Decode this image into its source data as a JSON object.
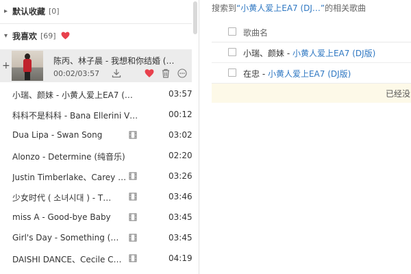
{
  "sidebar": {
    "default_fav": {
      "title": "默认收藏",
      "count": "[0]"
    },
    "liked": {
      "title": "我喜欢",
      "count": "[69]"
    }
  },
  "now_playing": {
    "title": "陈丙、林子晨 - 我想和你结婚 (…",
    "time": "00:02/03:57"
  },
  "songs": [
    {
      "name": "小瑞、颜妹 - 小黄人爱上EA7 (…",
      "duration": "03:57",
      "mv": false
    },
    {
      "name": "科科不是科科 - Bana Ellerini V…",
      "duration": "00:12",
      "mv": false
    },
    {
      "name": "Dua Lipa - Swan Song",
      "duration": "03:02",
      "mv": true
    },
    {
      "name": "Alonzo - Determine (纯音乐)",
      "duration": "02:20",
      "mv": false
    },
    {
      "name": "Justin Timberlake、Carey …",
      "duration": "03:26",
      "mv": true
    },
    {
      "name": "少女时代 ( 소녀시대 ) - T…",
      "duration": "03:46",
      "mv": true
    },
    {
      "name": "miss A - Good-bye Baby",
      "duration": "03:45",
      "mv": true
    },
    {
      "name": "Girl's Day - Something (…",
      "duration": "03:45",
      "mv": true
    },
    {
      "name": "DAISHI DANCE、Cecile C…",
      "duration": "04:19",
      "mv": true
    }
  ],
  "search": {
    "prefix": "搜索到",
    "query": "“小黄人爱上EA7 (DJ…”",
    "suffix": "的相关歌曲",
    "column_header": "歌曲名",
    "results": [
      {
        "artist": "小瑞、颜妹 - ",
        "title": "小黄人爱上EA7 (DJ版)"
      },
      {
        "artist": "在忠 - ",
        "title": "小黄人爱上EA7 (DJ版)"
      }
    ],
    "notice": "已经没"
  },
  "colors": {
    "accent_blue": "#2e77c2",
    "heart_red": "#e8414d",
    "notice_bg": "#fdf9e8"
  }
}
